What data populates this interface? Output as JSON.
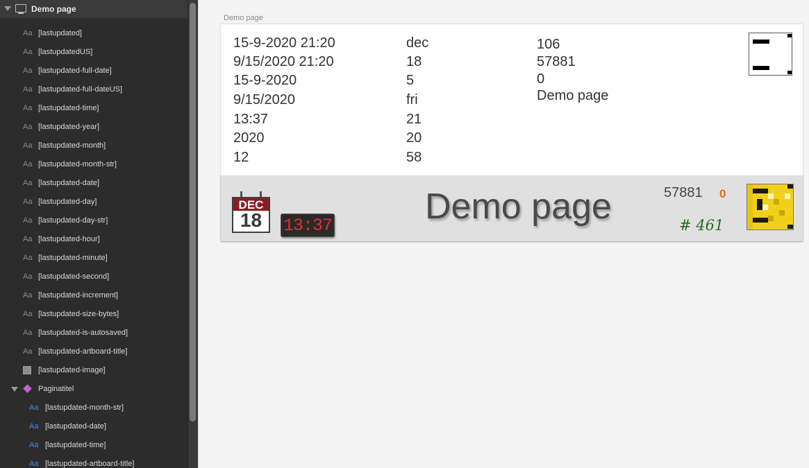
{
  "sidebar": {
    "header_title": "Demo page",
    "layers": [
      {
        "icon": "Aa",
        "label": "[lastupdated]"
      },
      {
        "icon": "Aa",
        "label": "[lastupdatedUS]"
      },
      {
        "icon": "Aa",
        "label": "[lastupdated-full-date]"
      },
      {
        "icon": "Aa",
        "label": "[lastupdated-full-dateUS]"
      },
      {
        "icon": "Aa",
        "label": "[lastupdated-time]"
      },
      {
        "icon": "Aa",
        "label": "[lastupdated-year]"
      },
      {
        "icon": "Aa",
        "label": "[lastupdated-month]"
      },
      {
        "icon": "Aa",
        "label": "[lastupdated-month-str]"
      },
      {
        "icon": "Aa",
        "label": "[lastupdated-date]"
      },
      {
        "icon": "Aa",
        "label": "[lastupdated-day]"
      },
      {
        "icon": "Aa",
        "label": "[lastupdated-day-str]"
      },
      {
        "icon": "Aa",
        "label": "[lastupdated-hour]"
      },
      {
        "icon": "Aa",
        "label": "[lastupdated-minute]"
      },
      {
        "icon": "Aa",
        "label": "[lastupdated-second]"
      },
      {
        "icon": "Aa",
        "label": "[lastupdated-increment]"
      },
      {
        "icon": "Aa",
        "label": "[lastupdated-size-bytes]"
      },
      {
        "icon": "Aa",
        "label": "[lastupdated-is-autosaved]"
      },
      {
        "icon": "Aa",
        "label": "[lastupdated-artboard-title]"
      },
      {
        "icon": "image-icon",
        "label": "[lastupdated-image]"
      }
    ],
    "group_label": "Paginatitel",
    "children": [
      {
        "icon": "Aa",
        "label": "[lastupdated-month-str]"
      },
      {
        "icon": "Aa",
        "label": "[lastupdated-date]"
      },
      {
        "icon": "Aa",
        "label": "[lastupdated-time]"
      },
      {
        "icon": "Aa",
        "label": "[lastupdated-artboard-title]"
      }
    ]
  },
  "artboard": {
    "title": "Demo page",
    "col1": [
      "15-9-2020 21:20",
      "9/15/2020 21:20",
      "15-9-2020",
      "9/15/2020",
      "13:37",
      "2020",
      "12"
    ],
    "col2": [
      "dec",
      "18",
      "5",
      "fri",
      "21",
      "20",
      "58"
    ],
    "col3": [
      "106",
      "57881",
      "0",
      "Demo page"
    ]
  },
  "pagination": {
    "calendar_month": "DEC",
    "calendar_day": "18",
    "clock_time": "13:37",
    "page_title": "Demo page",
    "size_bytes": "57881",
    "autosaved": "0",
    "increment": "# 461"
  },
  "colors": {
    "calendar_header": "#8b1d22",
    "clock_digits": "#e02d2d",
    "autosaved": "#e86b14",
    "increment": "#1f6e21",
    "thumbnail_fill": "#f0d01a"
  }
}
